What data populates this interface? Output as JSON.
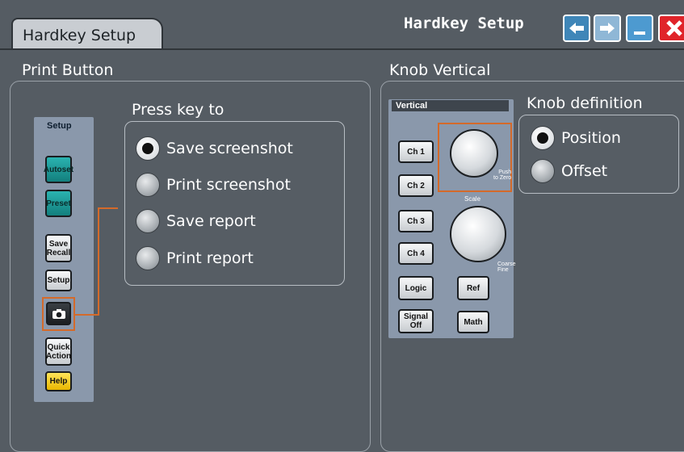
{
  "window": {
    "tab_label": "Hardkey Setup",
    "title": "Hardkey Setup",
    "buttons": [
      {
        "name": "undo",
        "icon": "undo-arrow-icon"
      },
      {
        "name": "redo",
        "icon": "redo-arrow-icon"
      },
      {
        "name": "minimize",
        "icon": "minimize-icon"
      },
      {
        "name": "close",
        "icon": "close-icon"
      }
    ]
  },
  "print_button": {
    "group_title": "Print Button",
    "panel_header": "Setup",
    "keys": [
      "Autoset",
      "Preset",
      "Save\nRecall",
      "Setup",
      "",
      "Quick\nAction",
      "Help"
    ],
    "highlighted_key_icon": "camera-icon",
    "press_key_title": "Press key to",
    "options": [
      {
        "label": "Save screenshot",
        "selected": true
      },
      {
        "label": "Print screenshot",
        "selected": false
      },
      {
        "label": "Save report",
        "selected": false
      },
      {
        "label": "Print report",
        "selected": false
      }
    ]
  },
  "knob_vertical": {
    "group_title": "Knob Vertical",
    "panel_header": "Vertical",
    "channel_keys": [
      "Ch 1",
      "Ch 2",
      "Ch 3",
      "Ch 4"
    ],
    "logic_key": "Logic",
    "ref_key": "Ref",
    "signal_off_key": "Signal\nOff",
    "math_key": "Math",
    "push_to_zero": "Push\nto Zero",
    "scale_label": "Scale",
    "coarse_fine": "Coarse\nFine",
    "definition_title": "Knob definition",
    "options": [
      {
        "label": "Position",
        "selected": true
      },
      {
        "label": "Offset",
        "selected": false
      }
    ]
  },
  "colors": {
    "background": "#555c63",
    "highlight": "#d46a2a",
    "teal_key": "#1f9997",
    "help_key": "#f2c600",
    "close": "#e0242a"
  }
}
